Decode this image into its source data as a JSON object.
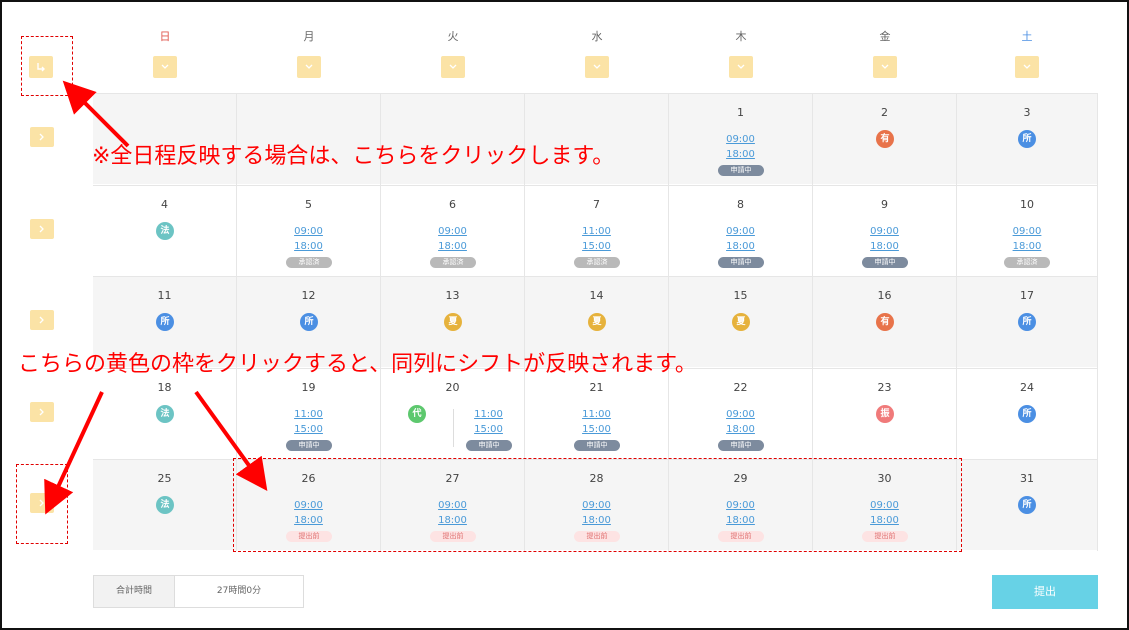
{
  "weekdays": [
    "日",
    "月",
    "火",
    "水",
    "木",
    "金",
    "土"
  ],
  "colors": {
    "sun": "#e0584f",
    "sat": "#4b8fe3",
    "yellow": "#fbe3a6",
    "submit": "#67d2e6",
    "annotation": "#ff0000"
  },
  "top_button_icon": "down-arrow-all-icon",
  "column_button_icon": "chevron-down-icon",
  "row_button_icon": "chevron-right-icon",
  "weeks": [
    [
      {},
      {},
      {},
      {},
      {
        "day": "1",
        "times": [
          "09:00",
          "18:00"
        ],
        "status": "申請中",
        "status_type": "apply"
      },
      {
        "day": "2",
        "badge": "有",
        "badge_color": "#e8734a"
      },
      {
        "day": "3",
        "badge": "所",
        "badge_color": "#4b8fe3"
      }
    ],
    [
      {
        "day": "4",
        "badge": "法",
        "badge_color": "#6cc4c4"
      },
      {
        "day": "5",
        "times": [
          "09:00",
          "18:00"
        ],
        "status": "承認済",
        "status_type": "ok"
      },
      {
        "day": "6",
        "times": [
          "09:00",
          "18:00"
        ],
        "status": "承認済",
        "status_type": "ok"
      },
      {
        "day": "7",
        "times": [
          "11:00",
          "15:00"
        ],
        "status": "承認済",
        "status_type": "ok"
      },
      {
        "day": "8",
        "times": [
          "09:00",
          "18:00"
        ],
        "status": "申請中",
        "status_type": "apply"
      },
      {
        "day": "9",
        "times": [
          "09:00",
          "18:00"
        ],
        "status": "申請中",
        "status_type": "apply"
      },
      {
        "day": "10",
        "times": [
          "09:00",
          "18:00"
        ],
        "status": "承認済",
        "status_type": "ok"
      }
    ],
    [
      {
        "day": "11",
        "badge": "所",
        "badge_color": "#4b8fe3"
      },
      {
        "day": "12",
        "badge": "所",
        "badge_color": "#4b8fe3"
      },
      {
        "day": "13",
        "badge": "夏",
        "badge_color": "#e6b23c"
      },
      {
        "day": "14",
        "badge": "夏",
        "badge_color": "#e6b23c"
      },
      {
        "day": "15",
        "badge": "夏",
        "badge_color": "#e6b23c"
      },
      {
        "day": "16",
        "badge": "有",
        "badge_color": "#e8734a"
      },
      {
        "day": "17",
        "badge": "所",
        "badge_color": "#4b8fe3"
      }
    ],
    [
      {
        "day": "18",
        "badge": "法",
        "badge_color": "#6cc4c4"
      },
      {
        "day": "19",
        "times": [
          "11:00",
          "15:00"
        ],
        "status": "申請中",
        "status_type": "apply"
      },
      {
        "day": "20",
        "badge": "代",
        "badge_color": "#5dc86e",
        "split": true,
        "times": [
          "11:00",
          "15:00"
        ],
        "status": "申請中",
        "status_type": "apply"
      },
      {
        "day": "21",
        "times": [
          "11:00",
          "15:00"
        ],
        "status": "申請中",
        "status_type": "apply"
      },
      {
        "day": "22",
        "times": [
          "09:00",
          "18:00"
        ],
        "status": "申請中",
        "status_type": "apply"
      },
      {
        "day": "23",
        "badge": "振",
        "badge_color": "#f07a7a"
      },
      {
        "day": "24",
        "badge": "所",
        "badge_color": "#4b8fe3"
      }
    ],
    [
      {
        "day": "25",
        "badge": "法",
        "badge_color": "#6cc4c4"
      },
      {
        "day": "26",
        "times": [
          "09:00",
          "18:00"
        ],
        "status": "提出前",
        "status_type": "pre"
      },
      {
        "day": "27",
        "times": [
          "09:00",
          "18:00"
        ],
        "status": "提出前",
        "status_type": "pre"
      },
      {
        "day": "28",
        "times": [
          "09:00",
          "18:00"
        ],
        "status": "提出前",
        "status_type": "pre"
      },
      {
        "day": "29",
        "times": [
          "09:00",
          "18:00"
        ],
        "status": "提出前",
        "status_type": "pre"
      },
      {
        "day": "30",
        "times": [
          "09:00",
          "18:00"
        ],
        "status": "提出前",
        "status_type": "pre"
      },
      {
        "day": "31",
        "badge": "所",
        "badge_color": "#4b8fe3"
      }
    ]
  ],
  "footer": {
    "total_label": "合計時間",
    "total_value": "27時間0分",
    "submit_label": "提出"
  },
  "annotations": {
    "note1": "※全日程反映する場合は、こちらをクリックします。",
    "note2": "こちらの黄色の枠をクリックすると、同列にシフトが反映されます。"
  }
}
